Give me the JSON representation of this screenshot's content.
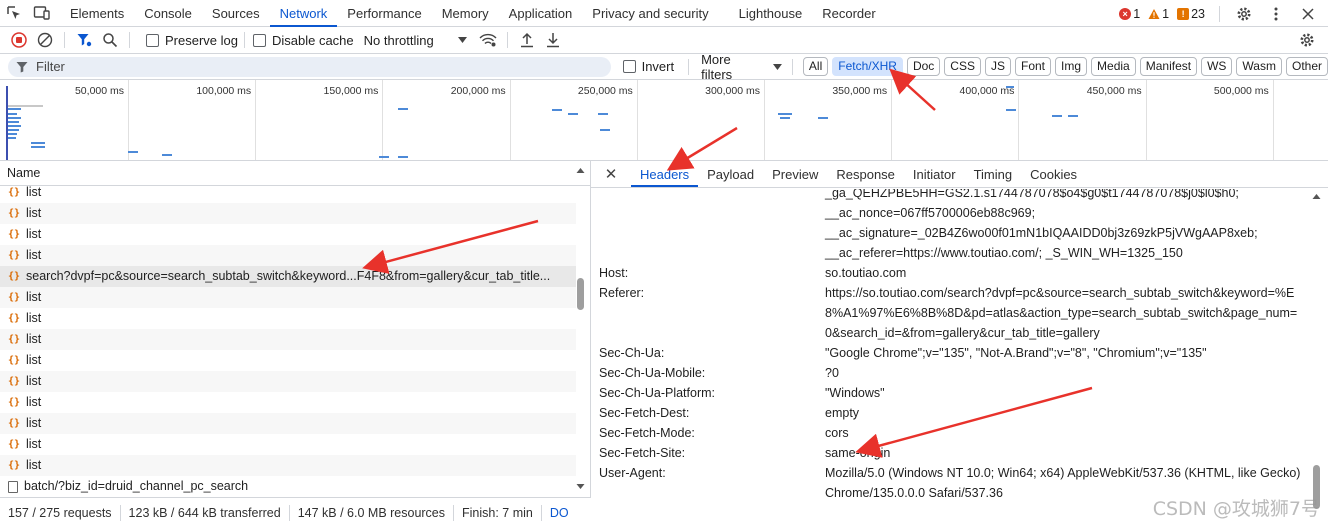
{
  "topbar": {
    "tabs": [
      "Elements",
      "Console",
      "Sources",
      "Network",
      "Performance",
      "Memory",
      "Application",
      "Privacy and security",
      "Lighthouse",
      "Recorder"
    ],
    "active_tab": "Network",
    "errors": "1",
    "warnings": "1",
    "issues": "23"
  },
  "toolbar": {
    "preserve_log": "Preserve log",
    "disable_cache": "Disable cache",
    "throttling": "No throttling"
  },
  "filter": {
    "placeholder": "Filter",
    "invert": "Invert",
    "more_filters": "More filters",
    "chips": [
      "All",
      "Fetch/XHR",
      "Doc",
      "CSS",
      "JS",
      "Font",
      "Img",
      "Media",
      "Manifest",
      "WS",
      "Wasm",
      "Other"
    ],
    "selected_chip": "Fetch/XHR"
  },
  "overview": {
    "ticks": [
      "50,000 ms",
      "100,000 ms",
      "150,000 ms",
      "200,000 ms",
      "250,000 ms",
      "300,000 ms",
      "350,000 ms",
      "400,000 ms",
      "450,000 ms",
      "500,000 ms"
    ]
  },
  "requests": {
    "column_name": "Name",
    "rows": [
      {
        "name": "list",
        "type": "xhr"
      },
      {
        "name": "list",
        "type": "xhr"
      },
      {
        "name": "list",
        "type": "xhr"
      },
      {
        "name": "list",
        "type": "xhr"
      },
      {
        "name": "search?dvpf=pc&source=search_subtab_switch&keyword...F4F8&from=gallery&cur_tab_title...",
        "type": "xhr",
        "highlighted": true
      },
      {
        "name": "list",
        "type": "xhr"
      },
      {
        "name": "list",
        "type": "xhr"
      },
      {
        "name": "list",
        "type": "xhr"
      },
      {
        "name": "list",
        "type": "xhr"
      },
      {
        "name": "list",
        "type": "xhr"
      },
      {
        "name": "list",
        "type": "xhr"
      },
      {
        "name": "list",
        "type": "xhr"
      },
      {
        "name": "list",
        "type": "xhr"
      },
      {
        "name": "list",
        "type": "xhr"
      },
      {
        "name": "batch/?biz_id=druid_channel_pc_search",
        "type": "doc"
      }
    ]
  },
  "status": {
    "requests": "157 / 275 requests",
    "transferred": "123 kB / 644 kB transferred",
    "resources": "147 kB / 6.0 MB resources",
    "finish": "Finish: 7 min",
    "dom": "DO"
  },
  "detail": {
    "tabs": [
      "Headers",
      "Payload",
      "Preview",
      "Response",
      "Initiator",
      "Timing",
      "Cookies"
    ],
    "active_tab": "Headers",
    "headers": [
      {
        "name": "",
        "value": "_ga_QEHZPBE5HH=GS2.1.s1744787078$o4$g0$t1744787078$j0$l0$h0;"
      },
      {
        "name": "",
        "value": "__ac_nonce=067ff5700006eb88c969;"
      },
      {
        "name": "",
        "value": "__ac_signature=_02B4Z6wo00f01mN1bIQAAIDD0bj3z69zkP5jVWgAAP8xeb;"
      },
      {
        "name": "",
        "value": "__ac_referer=https://www.toutiao.com/; _S_WIN_WH=1325_150"
      },
      {
        "name": "Host:",
        "value": "so.toutiao.com"
      },
      {
        "name": "Referer:",
        "value": "https://so.toutiao.com/search?dvpf=pc&source=search_subtab_switch&keyword=%E8%A1%97%E6%8B%8D&pd=atlas&action_type=search_subtab_switch&page_num=0&search_id=&from=gallery&cur_tab_title=gallery"
      },
      {
        "name": "Sec-Ch-Ua:",
        "value": "\"Google Chrome\";v=\"135\", \"Not-A.Brand\";v=\"8\", \"Chromium\";v=\"135\""
      },
      {
        "name": "Sec-Ch-Ua-Mobile:",
        "value": "?0"
      },
      {
        "name": "Sec-Ch-Ua-Platform:",
        "value": "\"Windows\""
      },
      {
        "name": "Sec-Fetch-Dest:",
        "value": "empty"
      },
      {
        "name": "Sec-Fetch-Mode:",
        "value": "cors"
      },
      {
        "name": "Sec-Fetch-Site:",
        "value": "same-origin"
      },
      {
        "name": "User-Agent:",
        "value": "Mozilla/5.0 (Windows NT 10.0; Win64; x64) AppleWebKit/537.36 (KHTML, like Gecko) Chrome/135.0.0.0 Safari/537.36"
      }
    ]
  },
  "watermark": "CSDN @攻城狮7号",
  "colors": {
    "accent": "#0b57d0",
    "arrow": "#e8322b",
    "chip_selected": "#d3e3fd"
  }
}
